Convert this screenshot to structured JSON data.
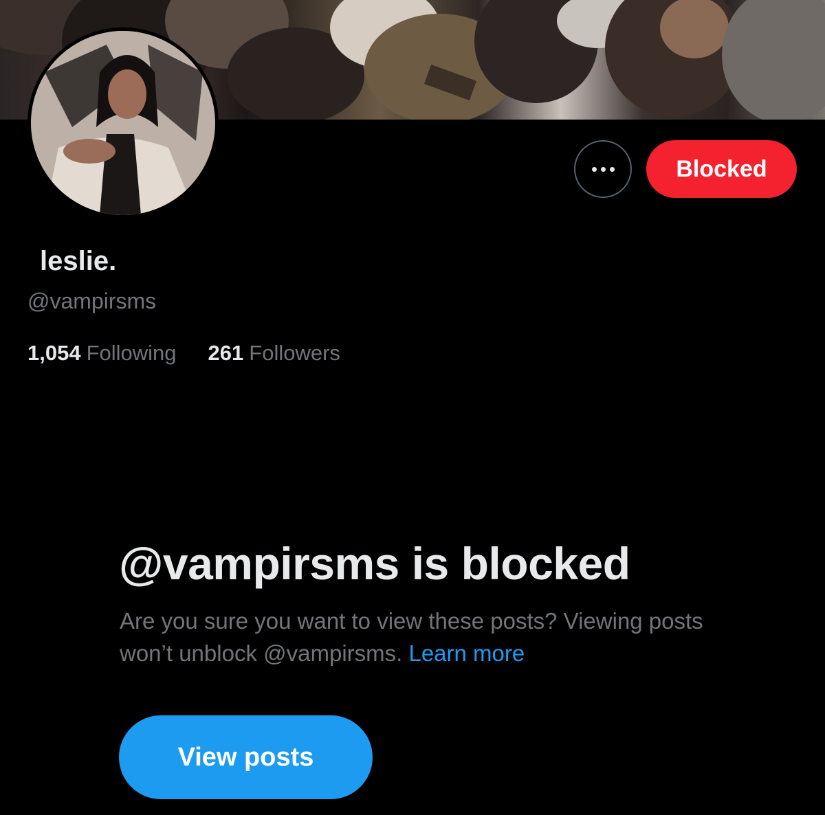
{
  "profile": {
    "display_name": "leslie.",
    "handle": "@vampirsms",
    "following_count": "1,054",
    "following_label": "Following",
    "followers_count": "261",
    "followers_label": "Followers"
  },
  "actions": {
    "more_icon": "more-horizontal-icon",
    "blocked_label": "Blocked"
  },
  "blocked_notice": {
    "title": "@vampirsms is blocked",
    "description": "Are you sure you want to view these posts? Viewing posts won’t unblock @vampirsms.",
    "learn_more": "Learn more",
    "view_posts_label": "View posts"
  },
  "colors": {
    "background": "#000000",
    "blocked_button": "#f4212e",
    "primary_button": "#1d9bf0",
    "link": "#1d9bf0",
    "secondary_text": "#71767b",
    "primary_text": "#e7e9ea"
  }
}
